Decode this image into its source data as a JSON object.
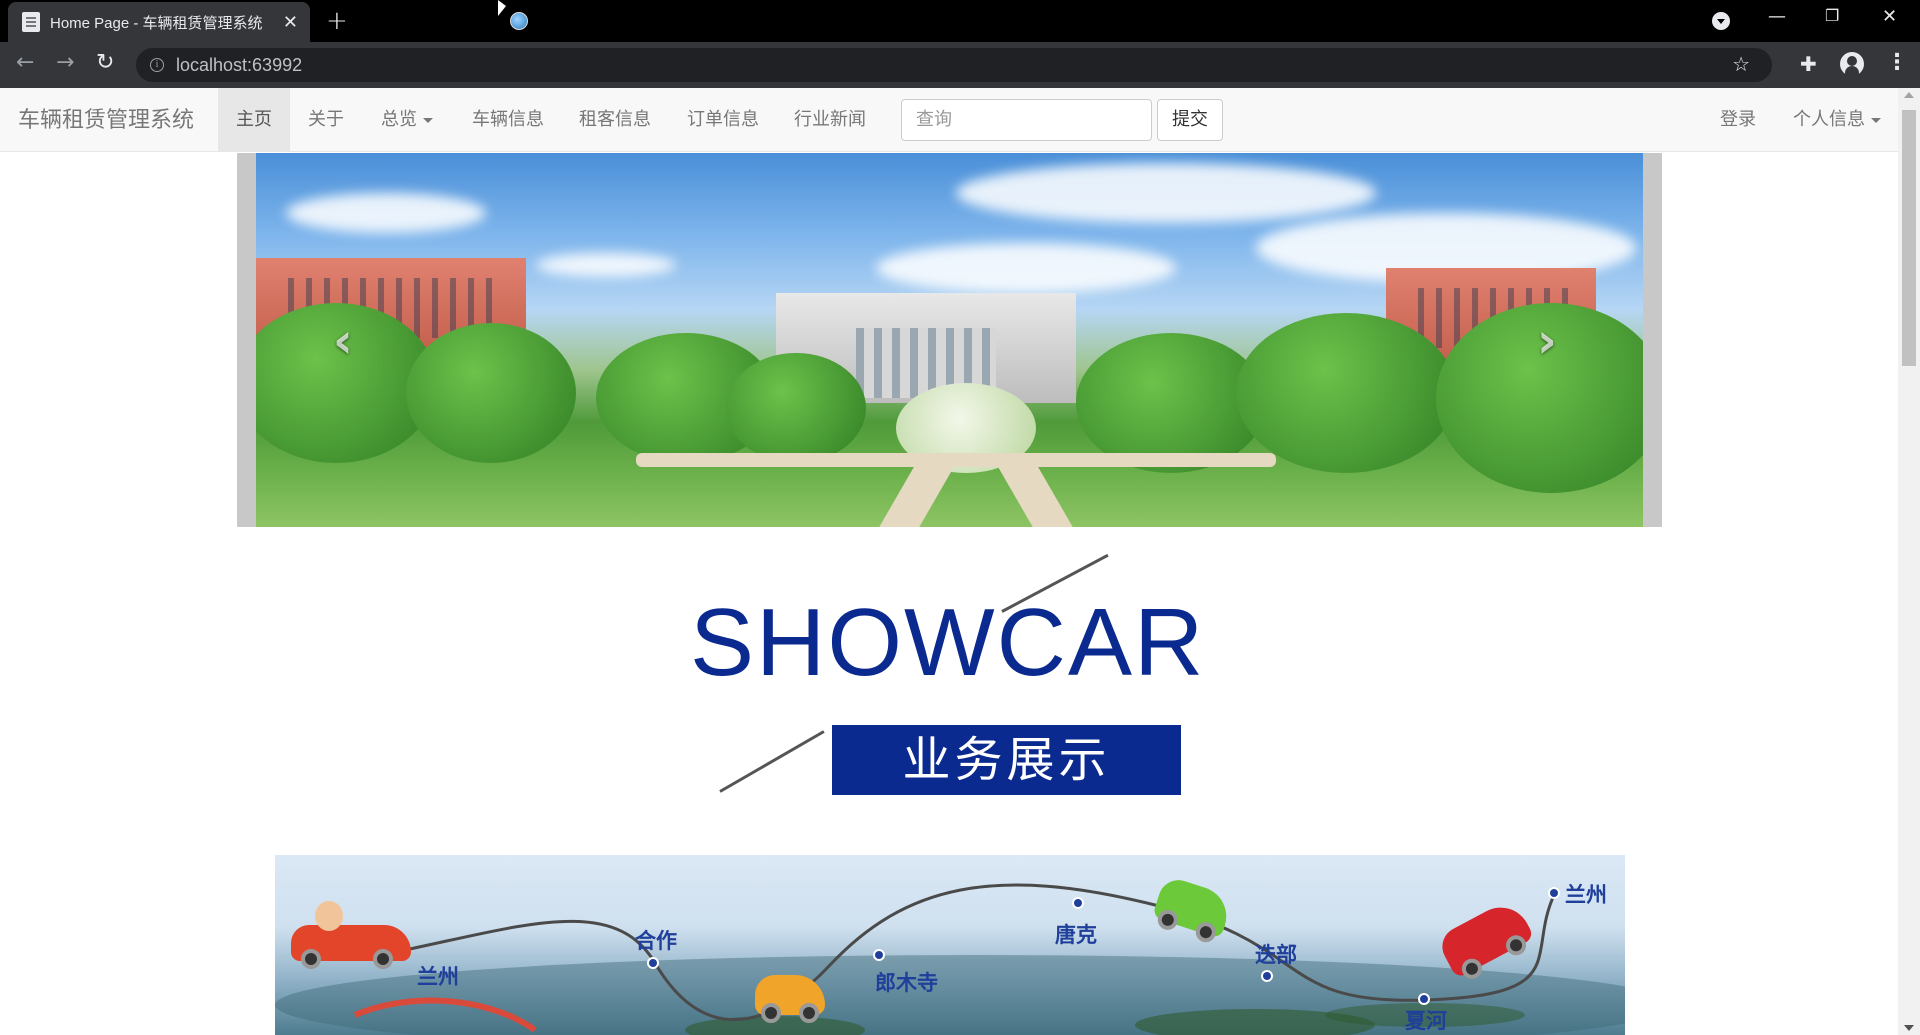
{
  "browser": {
    "tab_title": "Home Page - 车辆租赁管理系统",
    "new_tab_symbol": "+",
    "url": "localhost:63992",
    "window_controls": [
      "minimize",
      "restore",
      "close"
    ]
  },
  "navbar": {
    "brand": "车辆租赁管理系统",
    "items": [
      {
        "label": "主页",
        "active": true
      },
      {
        "label": "关于"
      },
      {
        "label": "总览",
        "dropdown": true
      },
      {
        "label": "车辆信息"
      },
      {
        "label": "租客信息"
      },
      {
        "label": "订单信息"
      },
      {
        "label": "行业新闻"
      }
    ],
    "search_placeholder": "查询",
    "submit_label": "提交",
    "login_label": "登录",
    "profile_label": "个人信息"
  },
  "carousel": {
    "slide_count": 3,
    "active_index": 1,
    "prev_symbol": "‹",
    "next_symbol": "›"
  },
  "showcase": {
    "title": "SHOWCAR",
    "subtitle": "业务展示"
  },
  "route": {
    "stops": [
      "兰州",
      "合作",
      "郎木寺",
      "唐克",
      "迭部",
      "夏河",
      "兰州"
    ]
  },
  "colors": {
    "brand_blue": "#0b2a8f",
    "navbar_bg": "#f8f8f8",
    "chrome_bg": "#35363a"
  }
}
